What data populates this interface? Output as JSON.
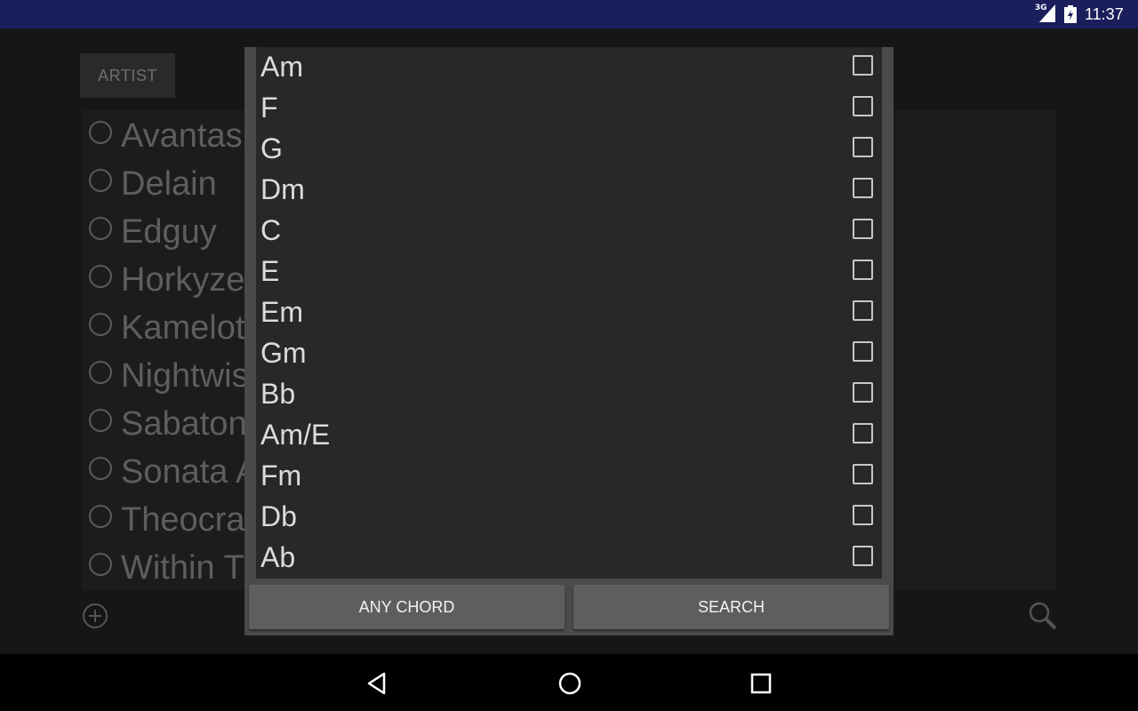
{
  "status_bar": {
    "network": "3G",
    "time": "11:37"
  },
  "background": {
    "tab_label": "ARTIST",
    "artists": [
      "Avantas",
      "Delain",
      "Edguy",
      "Horkyze",
      "Kamelot",
      "Nightwis",
      "Sabaton",
      "Sonata A",
      "Theocra",
      "Within T"
    ]
  },
  "dialog": {
    "chords": [
      "Am",
      "F",
      "G",
      "Dm",
      "C",
      "E",
      "Em",
      "Gm",
      "Bb",
      "Am/E",
      "Fm",
      "Db",
      "Ab"
    ],
    "any_chord_label": "ANY CHORD",
    "search_label": "SEARCH"
  }
}
